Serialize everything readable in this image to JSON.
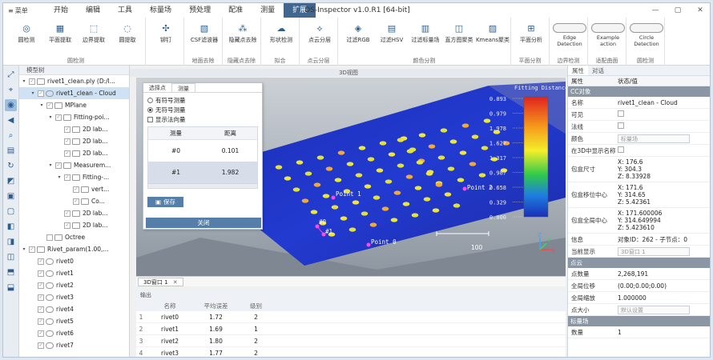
{
  "window": {
    "title": "DS-Inspector v1.0.R1 [64-bit]",
    "menu_label": "菜单",
    "menu_tabs": [
      "开始",
      "编辑",
      "工具",
      "标量场",
      "预处理",
      "配准",
      "测量",
      "扩展"
    ],
    "active_tab": "扩展",
    "controls": [
      "—",
      "▢",
      "✕"
    ]
  },
  "ribbon": {
    "groups": [
      {
        "title": "圆检测",
        "buttons": [
          "圆检测",
          "平面提取",
          "边界提取",
          "圆提取"
        ]
      },
      {
        "title": "",
        "buttons": [
          "铆钉"
        ]
      },
      {
        "title": "地面去除",
        "buttons": [
          "CSF滤波器"
        ]
      },
      {
        "title": "隐藏点去除",
        "buttons": [
          "隐藏点去除"
        ]
      },
      {
        "title": "拟合",
        "buttons": [
          "形状检测"
        ]
      },
      {
        "title": "点云分层",
        "buttons": [
          "点云分层"
        ]
      },
      {
        "title": "颜色分割",
        "buttons": [
          "过滤RGB",
          "过滤HSV",
          "过滤标量场",
          "直方图聚类",
          "Kmeans聚类"
        ]
      },
      {
        "title": "平面分割",
        "buttons": [
          "平面分析"
        ]
      },
      {
        "title": "边界检测",
        "buttons": [
          "Edge Detection"
        ]
      },
      {
        "title": "适配曲面",
        "buttons": [
          "Example action"
        ]
      },
      {
        "title": "圆检测",
        "buttons": [
          "Circle Detection"
        ]
      }
    ]
  },
  "tree": {
    "header": "模型树",
    "items": [
      {
        "label": "rivet1_clean.ply (D:/l...",
        "level": 0,
        "toggle": "▾",
        "icon": "folder",
        "checked": true,
        "selected": false
      },
      {
        "label": "rivet1_clean - Cloud",
        "level": 1,
        "toggle": "▾",
        "icon": "cloud",
        "checked": true,
        "selected": true
      },
      {
        "label": "MPlane",
        "level": 2,
        "toggle": "▾",
        "icon": "folder",
        "checked": true,
        "selected": false
      },
      {
        "label": "Fitting-poi...",
        "level": 3,
        "toggle": "▾",
        "icon": "folder",
        "checked": true,
        "selected": false
      },
      {
        "label": "2D lab...",
        "level": 4,
        "toggle": "",
        "icon": "box",
        "checked": true,
        "selected": false
      },
      {
        "label": "2D lab...",
        "level": 4,
        "toggle": "",
        "icon": "box",
        "checked": true,
        "selected": false
      },
      {
        "label": "2D lab...",
        "level": 4,
        "toggle": "",
        "icon": "box",
        "checked": true,
        "selected": false
      },
      {
        "label": "Measurem...",
        "level": 3,
        "toggle": "▾",
        "icon": "folder",
        "checked": true,
        "selected": false
      },
      {
        "label": "Fitting-...",
        "level": 4,
        "toggle": "▾",
        "icon": "box",
        "checked": true,
        "selected": false
      },
      {
        "label": "vert...",
        "level": 5,
        "toggle": "",
        "icon": "box",
        "checked": true,
        "selected": false
      },
      {
        "label": "Co...",
        "level": 5,
        "toggle": "",
        "icon": "box",
        "checked": true,
        "selected": false
      },
      {
        "label": "2D lab...",
        "level": 4,
        "toggle": "",
        "icon": "box",
        "checked": true,
        "selected": false
      },
      {
        "label": "2D lab...",
        "level": 4,
        "toggle": "",
        "icon": "box",
        "checked": true,
        "selected": false
      },
      {
        "label": "Octree",
        "level": 2,
        "toggle": "",
        "icon": "box",
        "checked": false,
        "selected": false
      },
      {
        "label": "Rivet_param(1.00,...",
        "level": 0,
        "toggle": "▾",
        "icon": "folder",
        "checked": true,
        "selected": false
      },
      {
        "label": "rivet0",
        "level": 1,
        "toggle": "",
        "icon": "cloud",
        "checked": true,
        "selected": false
      },
      {
        "label": "rivet1",
        "level": 1,
        "toggle": "",
        "icon": "cloud",
        "checked": true,
        "selected": false
      },
      {
        "label": "rivet2",
        "level": 1,
        "toggle": "",
        "icon": "cloud",
        "checked": true,
        "selected": false
      },
      {
        "label": "rivet3",
        "level": 1,
        "toggle": "",
        "icon": "cloud",
        "checked": true,
        "selected": false
      },
      {
        "label": "rivet4",
        "level": 1,
        "toggle": "",
        "icon": "cloud",
        "checked": true,
        "selected": false
      },
      {
        "label": "rivet5",
        "level": 1,
        "toggle": "",
        "icon": "cloud",
        "checked": true,
        "selected": false
      },
      {
        "label": "rivet6",
        "level": 1,
        "toggle": "",
        "icon": "cloud",
        "checked": true,
        "selected": false
      },
      {
        "label": "rivet7",
        "level": 1,
        "toggle": "",
        "icon": "cloud",
        "checked": true,
        "selected": false
      }
    ]
  },
  "viewport": {
    "title": "3D视图",
    "tab_label": "3D窗口 1",
    "tab_close": "✕",
    "points": [
      "Point 1",
      "Point 2",
      "Point 0",
      "#0",
      "#1"
    ],
    "scale_label": "100",
    "colorbar": {
      "title": "Fitting Distance",
      "ticks": [
        "0.893",
        "0.979",
        "1.978",
        "1.627",
        "1.317",
        "0.987",
        "0.658",
        "0.329",
        "0.000"
      ]
    },
    "axes": [
      "Z",
      "X",
      "Y"
    ]
  },
  "dialog": {
    "tabs": [
      "选择点",
      "测量"
    ],
    "active_tab": "测量",
    "options": [
      {
        "label": "有符号测量",
        "selected": false
      },
      {
        "label": "无符号测量",
        "selected": true
      }
    ],
    "show_normal": "显示法向量",
    "headers": [
      "测量",
      "距离"
    ],
    "rows": [
      {
        "id": "#0",
        "value": "0.101"
      },
      {
        "id": "#1",
        "value": "1.982"
      }
    ],
    "save_label": "保存",
    "close_label": "关闭"
  },
  "output": {
    "title": "输出",
    "headers": [
      "名称",
      "平均误差",
      "级别"
    ],
    "rows": [
      {
        "idx": "1",
        "name": "rivet0",
        "error": "1.72",
        "level": "2"
      },
      {
        "idx": "2",
        "name": "rivet1",
        "error": "1.69",
        "level": "1"
      },
      {
        "idx": "3",
        "name": "rivet2",
        "error": "1.80",
        "level": "2"
      },
      {
        "idx": "4",
        "name": "rivet3",
        "error": "1.77",
        "level": "2"
      }
    ]
  },
  "properties": {
    "tabs": [
      "属性",
      "对话"
    ],
    "headers": [
      "属性",
      "状态/值"
    ],
    "sections": [
      {
        "title": "CC对象",
        "rows": [
          {
            "key": "名称",
            "value": "rivet1_clean - Cloud",
            "type": "text"
          },
          {
            "key": "可见",
            "value": "",
            "type": "check"
          },
          {
            "key": "法线",
            "value": "",
            "type": "check"
          },
          {
            "key": "颜色",
            "value": "标量场",
            "type": "dropdown"
          },
          {
            "key": "在3D中显示名称",
            "value": "",
            "type": "check"
          },
          {
            "key": "包盒尺寸",
            "value": "X: 176.6\nY: 304.3\nZ: 8.33928",
            "type": "multi"
          },
          {
            "key": "包盒移位中心",
            "value": "X: 171.6\nY: 314.65\nZ: 5.42361",
            "type": "multi"
          },
          {
            "key": "包盒全局中心",
            "value": "X: 171.600006\nY: 314.649994\nZ: 5.423610",
            "type": "multi"
          },
          {
            "key": "信息",
            "value": "对象ID：262 - 子节点：0",
            "type": "text"
          },
          {
            "key": "当前显示",
            "value": "3D窗口 1",
            "type": "dropdown"
          }
        ]
      },
      {
        "title": "点云",
        "rows": [
          {
            "key": "点数量",
            "value": "2,268,191",
            "type": "text"
          },
          {
            "key": "全局位移",
            "value": "(0.00;0.00;0.00)",
            "type": "text"
          },
          {
            "key": "全局缩放",
            "value": "1.000000",
            "type": "text"
          },
          {
            "key": "点大小",
            "value": "默认设置",
            "type": "dropdown"
          }
        ]
      },
      {
        "title": "标量场",
        "rows": [
          {
            "key": "数量",
            "value": "1",
            "type": "text"
          }
        ]
      }
    ]
  }
}
